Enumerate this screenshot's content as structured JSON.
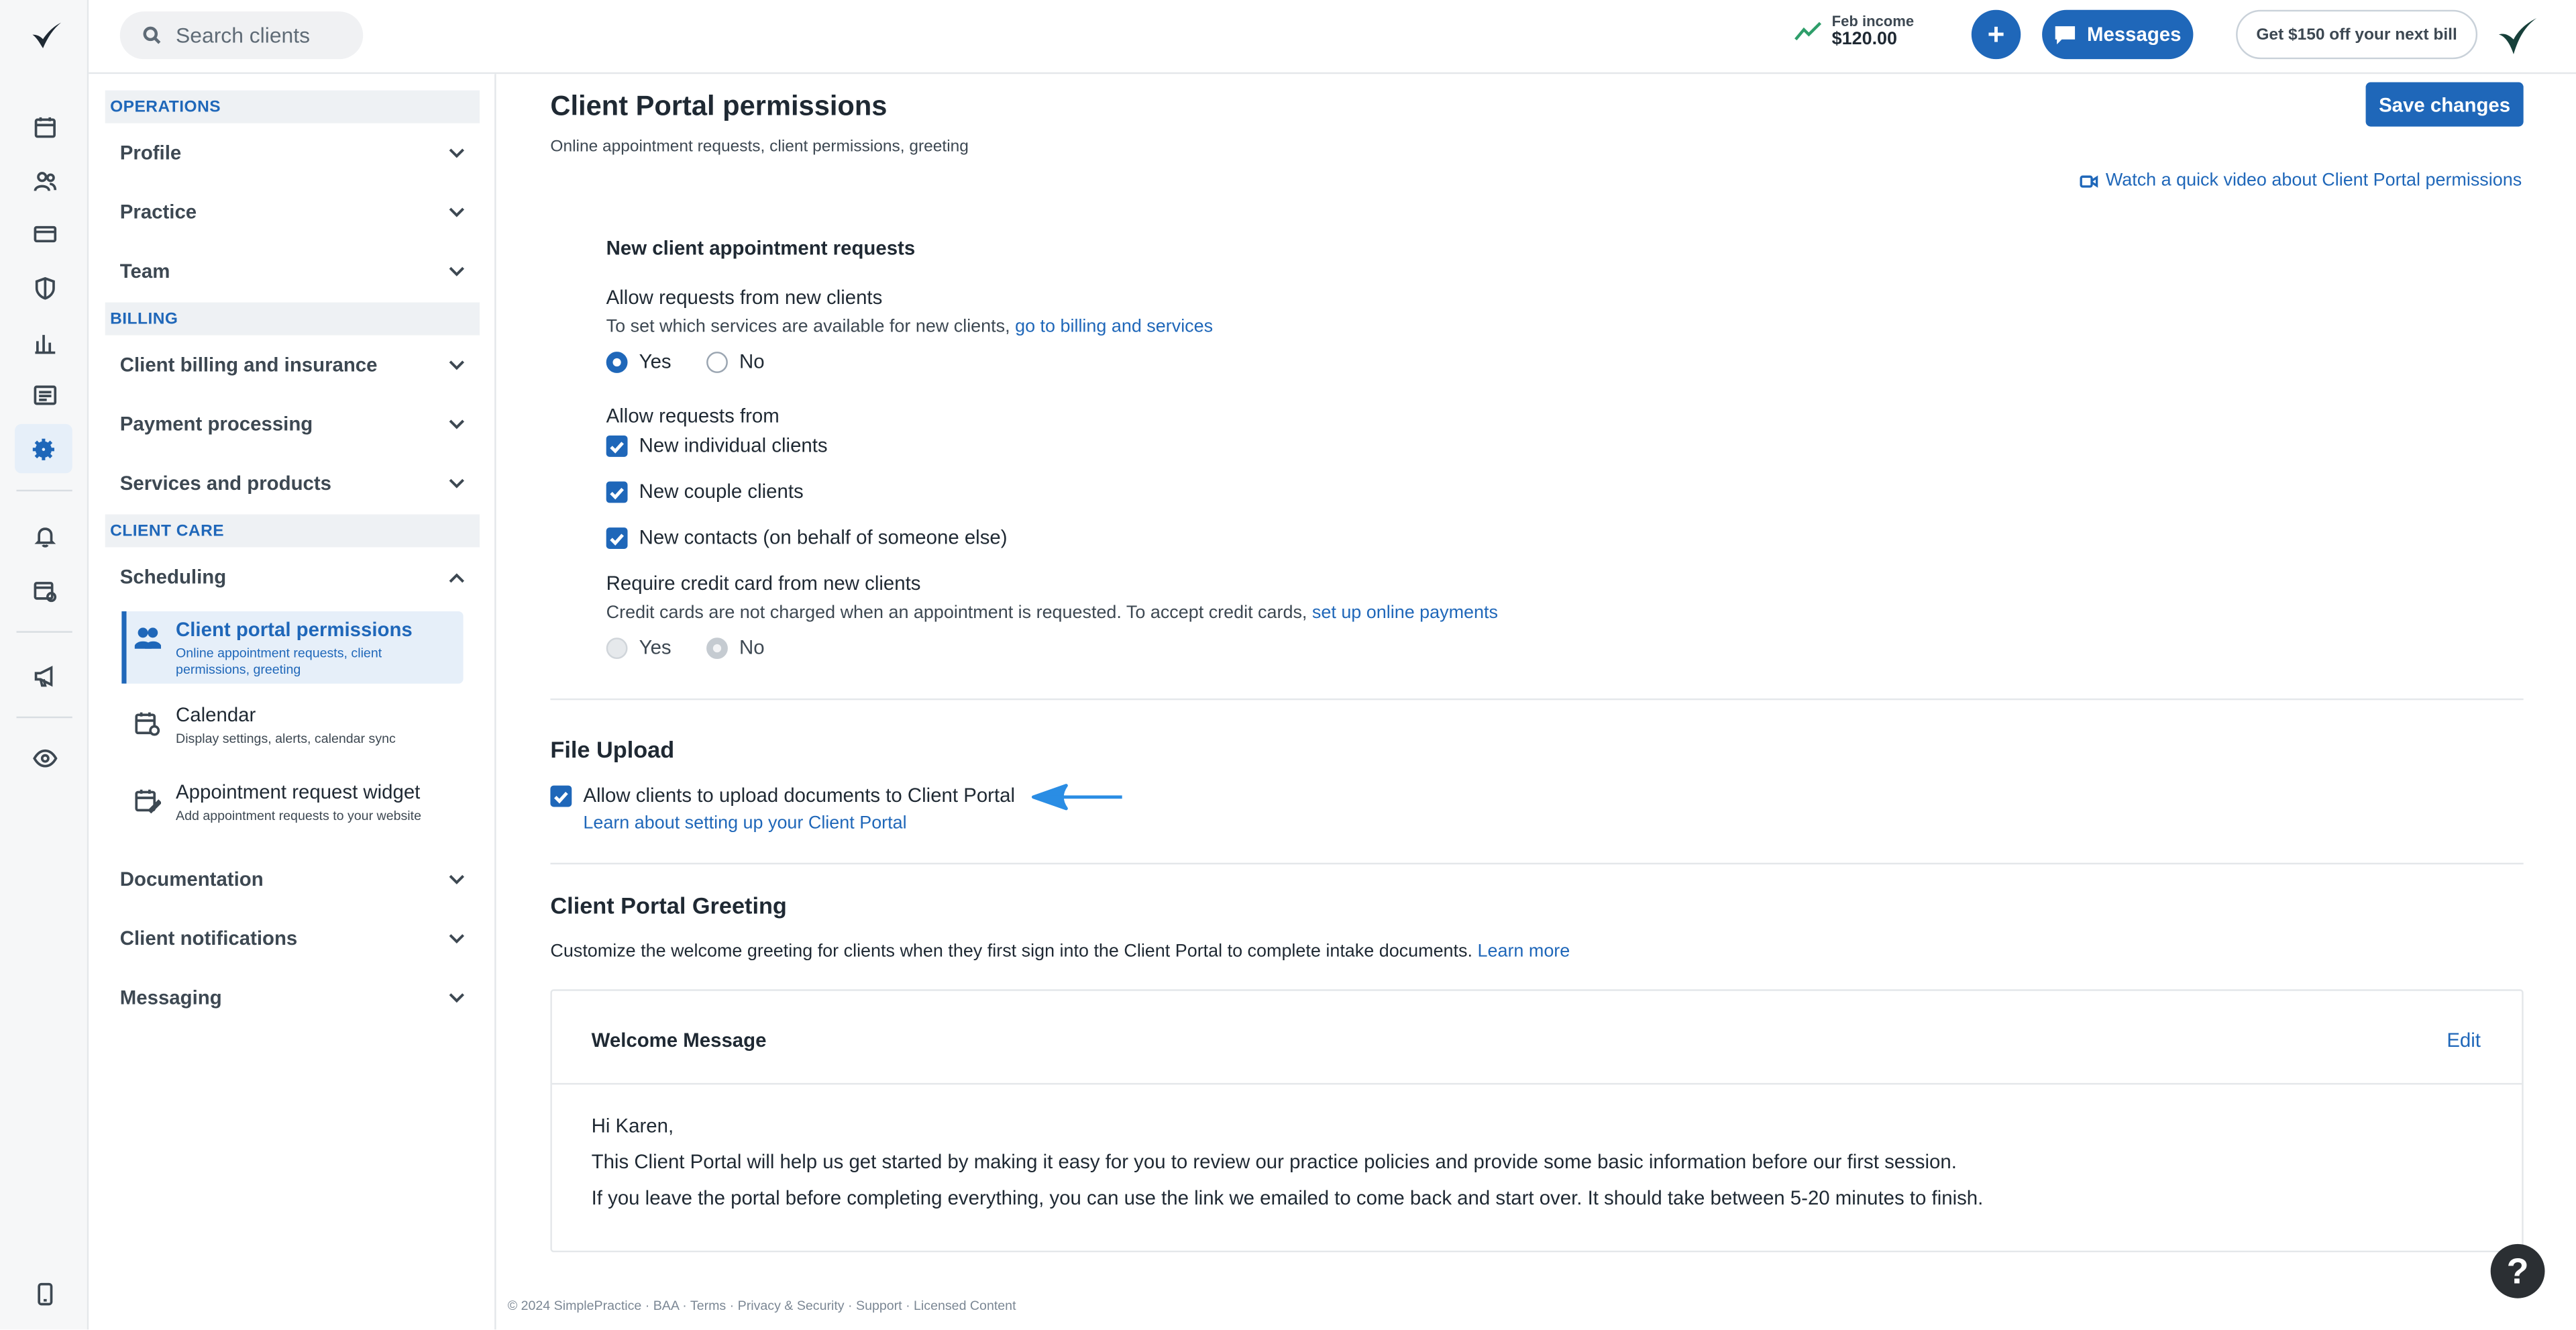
{
  "topbar": {
    "search_placeholder": "Search clients",
    "income_label": "Feb income",
    "income_value": "$120.00",
    "messages_label": "Messages",
    "promo_label": "Get $150 off your next bill"
  },
  "sidebar": {
    "sections": {
      "operations": "OPERATIONS",
      "billing": "BILLING",
      "client_care": "CLIENT CARE"
    },
    "items": {
      "profile": "Profile",
      "practice": "Practice",
      "team": "Team",
      "client_billing": "Client billing and insurance",
      "payment_processing": "Payment processing",
      "services_products": "Services and products",
      "scheduling": "Scheduling",
      "documentation": "Documentation",
      "client_notifications": "Client notifications",
      "messaging": "Messaging"
    },
    "scheduling_sub": {
      "portal_title": "Client portal permissions",
      "portal_desc": "Online appointment requests, client permissions, greeting",
      "calendar_title": "Calendar",
      "calendar_desc": "Display settings, alerts, calendar sync",
      "widget_title": "Appointment request widget",
      "widget_desc": "Add appointment requests to your website"
    }
  },
  "main": {
    "title": "Client Portal permissions",
    "subtitle": "Online appointment requests, client permissions, greeting",
    "save_label": "Save changes",
    "video_link": "Watch a quick video about Client Portal permissions",
    "new_requests": {
      "heading": "New client appointment requests",
      "allow_label": "Allow requests from new clients",
      "allow_hint": "To set which services are available for new clients,",
      "allow_hint_link": "go to billing and services",
      "yes": "Yes",
      "no": "No",
      "allow_from_label": "Allow requests from",
      "opt_individual": "New individual clients",
      "opt_couple": "New couple clients",
      "opt_contacts": "New contacts (on behalf of someone else)",
      "credit_label": "Require credit card from new clients",
      "credit_hint": "Credit cards are not charged when an appointment is requested. To accept credit cards,",
      "credit_hint_link": "set up online payments"
    },
    "file_upload": {
      "heading": "File Upload",
      "checkbox_label": "Allow clients to upload documents to Client Portal",
      "learn_link": "Learn about setting up your Client Portal"
    },
    "greeting": {
      "heading": "Client Portal Greeting",
      "desc": "Customize the welcome greeting for clients when they first sign into the Client Portal to complete intake documents.",
      "learn_more": "Learn more",
      "box_title": "Welcome Message",
      "edit_label": "Edit",
      "line1": "Hi Karen,",
      "line2": "This Client Portal will help us get started by making it easy for you to review our practice policies and provide some basic information before our first session.",
      "line3": "If you leave the portal before completing everything, you can use the link we emailed to come back and start over. It should take between 5-20 minutes to finish."
    }
  },
  "footer": "© 2024 SimplePractice · BAA · Terms · Privacy & Security · Support · Licensed Content",
  "help_label": "?",
  "colors": {
    "accent": "#1f67b9",
    "income_trend": "#2e9e6a",
    "arrow": "#2a8de4"
  }
}
